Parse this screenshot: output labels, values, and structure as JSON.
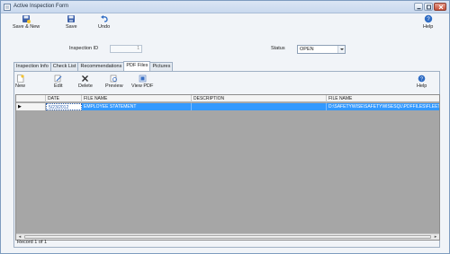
{
  "window": {
    "title": "Active Inspection Form"
  },
  "toolbar": {
    "save_new": "Save & New",
    "save": "Save",
    "undo": "Undo",
    "help": "Help"
  },
  "filter": {
    "inspection_id_label": "Inspection ID",
    "inspection_id_value": "1",
    "status_label": "Status",
    "status_value": "OPEN"
  },
  "tabs": [
    "Inspection Info",
    "Check List",
    "Recommendations",
    "PDF Files",
    "Pictures"
  ],
  "active_tab": "PDF Files",
  "subtoolbar": {
    "new": "New",
    "edit": "Edit",
    "delete": "Delete",
    "preview": "Preview",
    "view_pdf": "View PDF",
    "help": "Help"
  },
  "grid": {
    "columns": [
      "DATE",
      "FILE NAME",
      "DESCRIPTION",
      "FILE NAME"
    ],
    "rows": [
      {
        "indicator": "▶",
        "date": "5/23/2012",
        "file_name": "EMPLOYEE STATEMENT",
        "description": "",
        "file_path": "D:\\SAFETYWISE\\SAFETYWISESQL\\PDFFILES\\FLEETWISE"
      }
    ]
  },
  "footer": {
    "record_text": "Record 1 of 1"
  },
  "colors": {
    "selection": "#3399ff",
    "grid_bg": "#a6a6a6",
    "chrome": "#f1f4f8"
  }
}
